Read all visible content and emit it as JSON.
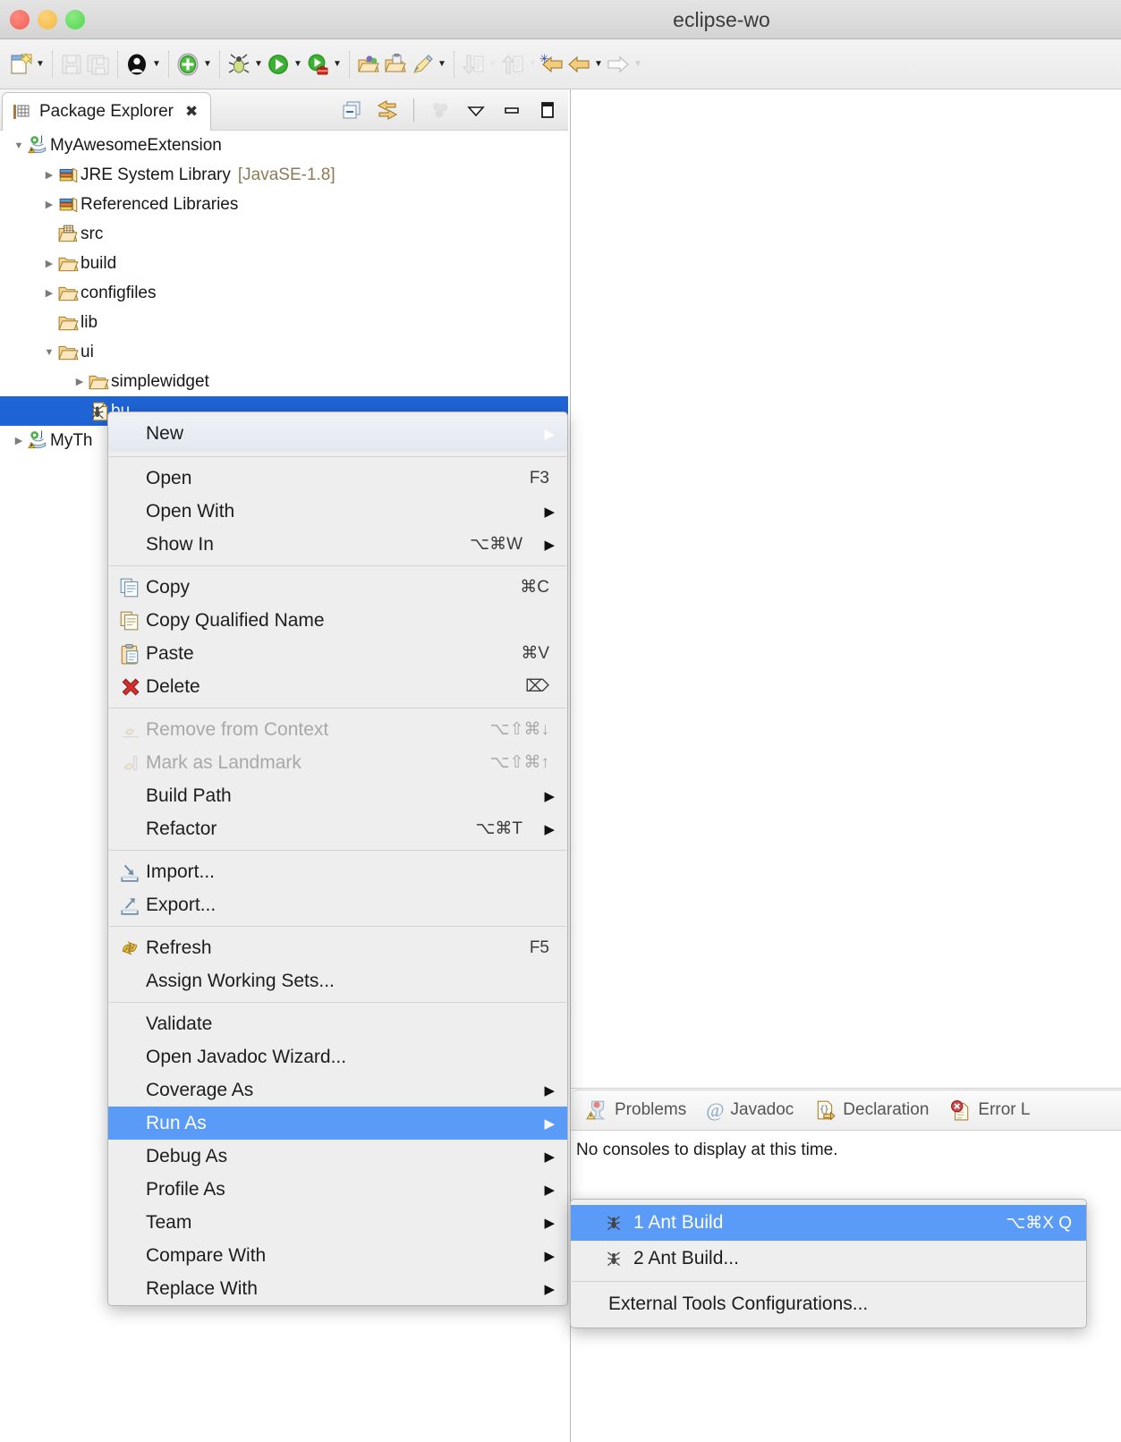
{
  "window": {
    "title": "eclipse-wo"
  },
  "toolbar": {
    "items": [
      {
        "name": "new-wizard-dropdown",
        "icon": "new-file-icon",
        "has_arrow": true,
        "enabled": true
      },
      {
        "name": "save-button",
        "icon": "save-icon",
        "has_arrow": false,
        "enabled": false
      },
      {
        "name": "save-all-button",
        "icon": "save-all-icon",
        "has_arrow": false,
        "enabled": false
      },
      {
        "name": "person-dropdown",
        "icon": "person-icon",
        "has_arrow": true,
        "enabled": true
      },
      {
        "name": "new-element-dropdown",
        "icon": "green-plus-icon",
        "has_arrow": true,
        "enabled": true
      },
      {
        "name": "debug-dropdown",
        "icon": "bug-icon",
        "has_arrow": true,
        "enabled": true
      },
      {
        "name": "run-dropdown",
        "icon": "run-icon",
        "has_arrow": true,
        "enabled": true
      },
      {
        "name": "external-tools-dropdown",
        "icon": "external-tools-icon",
        "has_arrow": true,
        "enabled": true
      },
      {
        "name": "open-type-button",
        "icon": "open-type-icon",
        "has_arrow": false,
        "enabled": true
      },
      {
        "name": "open-task-button",
        "icon": "open-task-icon",
        "has_arrow": false,
        "enabled": true
      },
      {
        "name": "search-pen-dropdown",
        "icon": "pencil-icon",
        "has_arrow": true,
        "enabled": true
      },
      {
        "name": "next-annotation-dropdown",
        "icon": "down-arrow-annotation-icon",
        "has_arrow": true,
        "enabled": false
      },
      {
        "name": "previous-annotation-dropdown",
        "icon": "up-arrow-annotation-icon",
        "has_arrow": true,
        "enabled": false
      },
      {
        "name": "last-edit-location-button",
        "icon": "back-star-icon",
        "has_arrow": false,
        "enabled": true
      },
      {
        "name": "back-dropdown",
        "icon": "back-arrow-icon",
        "has_arrow": true,
        "enabled": true
      },
      {
        "name": "forward-dropdown",
        "icon": "forward-arrow-icon",
        "has_arrow": true,
        "enabled": false
      }
    ]
  },
  "explorer": {
    "tab_label": "Package Explorer",
    "close_glyph": "✖",
    "actions": [
      {
        "name": "collapse-all-icon",
        "label": "Collapse All"
      },
      {
        "name": "link-with-editor-icon",
        "label": "Link with Editor"
      },
      {
        "name": "focus-on-active-task-icon",
        "label": "Focus on Active Task"
      },
      {
        "name": "view-menu-icon",
        "label": "View Menu"
      },
      {
        "name": "minimize-icon",
        "label": "Minimize"
      },
      {
        "name": "maximize-icon",
        "label": "Maximize"
      }
    ],
    "tree": [
      {
        "label": "MyAwesomeExtension",
        "extra": "",
        "indent": 0,
        "twist": "open",
        "icon": "java-project-warning-icon",
        "selected": false
      },
      {
        "label": "JRE System Library",
        "extra": "[JavaSE-1.8]",
        "indent": 1,
        "twist": "closed",
        "icon": "library-icon",
        "selected": false
      },
      {
        "label": "Referenced Libraries",
        "extra": "",
        "indent": 1,
        "twist": "closed",
        "icon": "library-icon",
        "selected": false
      },
      {
        "label": "src",
        "extra": "",
        "indent": 1,
        "twist": "none",
        "icon": "source-folder-icon",
        "selected": false
      },
      {
        "label": "build",
        "extra": "",
        "indent": 1,
        "twist": "closed",
        "icon": "folder-icon",
        "selected": false
      },
      {
        "label": "configfiles",
        "extra": "",
        "indent": 1,
        "twist": "closed",
        "icon": "folder-icon",
        "selected": false
      },
      {
        "label": "lib",
        "extra": "",
        "indent": 1,
        "twist": "none",
        "icon": "folder-icon",
        "selected": false
      },
      {
        "label": "ui",
        "extra": "",
        "indent": 1,
        "twist": "open",
        "icon": "folder-icon",
        "selected": false
      },
      {
        "label": "simplewidget",
        "extra": "",
        "indent": 2,
        "twist": "closed",
        "icon": "folder-icon",
        "selected": false
      },
      {
        "label": "bu",
        "extra": "",
        "indent": 2,
        "twist": "none",
        "icon": "ant-build-file-icon",
        "selected": true
      },
      {
        "label": "MyTh",
        "extra": "",
        "indent": 0,
        "twist": "closed",
        "icon": "java-project-warning-icon",
        "selected": false
      }
    ]
  },
  "context_menu": {
    "groups": [
      [
        {
          "label": "New",
          "key": "",
          "arrow": true,
          "icon": "",
          "state": "hover"
        }
      ],
      [
        {
          "label": "Open",
          "key": "F3",
          "arrow": false,
          "icon": "",
          "state": "normal"
        },
        {
          "label": "Open With",
          "key": "",
          "arrow": true,
          "icon": "",
          "state": "normal"
        },
        {
          "label": "Show In",
          "key": "⌥⌘W",
          "arrow": true,
          "icon": "",
          "state": "normal"
        }
      ],
      [
        {
          "label": "Copy",
          "key": "⌘C",
          "arrow": false,
          "icon": "copy-icon",
          "state": "normal"
        },
        {
          "label": "Copy Qualified Name",
          "key": "",
          "arrow": false,
          "icon": "copy-qualified-icon",
          "state": "normal"
        },
        {
          "label": "Paste",
          "key": "⌘V",
          "arrow": false,
          "icon": "paste-icon",
          "state": "normal"
        },
        {
          "label": "Delete",
          "key": "⌦",
          "arrow": false,
          "icon": "delete-x-icon",
          "state": "normal"
        }
      ],
      [
        {
          "label": "Remove from Context",
          "key": "⌥⇧⌘↓",
          "arrow": false,
          "icon": "remove-context-icon",
          "state": "disabled"
        },
        {
          "label": "Mark as Landmark",
          "key": "⌥⇧⌘↑",
          "arrow": false,
          "icon": "landmark-icon",
          "state": "disabled"
        },
        {
          "label": "Build Path",
          "key": "",
          "arrow": true,
          "icon": "",
          "state": "normal"
        },
        {
          "label": "Refactor",
          "key": "⌥⌘T",
          "arrow": true,
          "icon": "",
          "state": "normal"
        }
      ],
      [
        {
          "label": "Import...",
          "key": "",
          "arrow": false,
          "icon": "import-icon",
          "state": "normal"
        },
        {
          "label": "Export...",
          "key": "",
          "arrow": false,
          "icon": "export-icon",
          "state": "normal"
        }
      ],
      [
        {
          "label": "Refresh",
          "key": "F5",
          "arrow": false,
          "icon": "refresh-icon",
          "state": "normal"
        },
        {
          "label": "Assign Working Sets...",
          "key": "",
          "arrow": false,
          "icon": "",
          "state": "normal"
        }
      ],
      [
        {
          "label": "Validate",
          "key": "",
          "arrow": false,
          "icon": "",
          "state": "normal"
        },
        {
          "label": "Open Javadoc Wizard...",
          "key": "",
          "arrow": false,
          "icon": "",
          "state": "normal"
        },
        {
          "label": "Coverage As",
          "key": "",
          "arrow": true,
          "icon": "",
          "state": "normal"
        },
        {
          "label": "Run As",
          "key": "",
          "arrow": true,
          "icon": "",
          "state": "selected"
        },
        {
          "label": "Debug As",
          "key": "",
          "arrow": true,
          "icon": "",
          "state": "normal"
        },
        {
          "label": "Profile As",
          "key": "",
          "arrow": true,
          "icon": "",
          "state": "normal"
        },
        {
          "label": "Team",
          "key": "",
          "arrow": true,
          "icon": "",
          "state": "normal"
        },
        {
          "label": "Compare With",
          "key": "",
          "arrow": true,
          "icon": "",
          "state": "normal"
        },
        {
          "label": "Replace With",
          "key": "",
          "arrow": true,
          "icon": "",
          "state": "normal"
        }
      ]
    ]
  },
  "submenu": {
    "items": [
      {
        "label": "1 Ant Build",
        "key": "⌥⌘X Q",
        "icon": "ant-icon",
        "state": "selected"
      },
      {
        "label": "2 Ant Build...",
        "key": "",
        "icon": "ant-icon",
        "state": "normal"
      },
      {
        "separator": true
      },
      {
        "label": "External Tools Configurations...",
        "key": "",
        "icon": "",
        "state": "normal"
      }
    ]
  },
  "console": {
    "tabs": [
      {
        "label": "Problems",
        "icon": "problems-icon",
        "active": false
      },
      {
        "label": "Javadoc",
        "icon": "at-sign-icon",
        "active": false
      },
      {
        "label": "Declaration",
        "icon": "declaration-icon",
        "active": false
      },
      {
        "label": "Error L",
        "icon": "error-log-icon",
        "active": false
      }
    ],
    "message": "No consoles to display at this time."
  },
  "colors": {
    "selection_blue": "#1f64d6",
    "menu_highlight": "#5b9bf8",
    "menu_bg": "#eeeeee",
    "titlebar": "#d8d8d8"
  }
}
